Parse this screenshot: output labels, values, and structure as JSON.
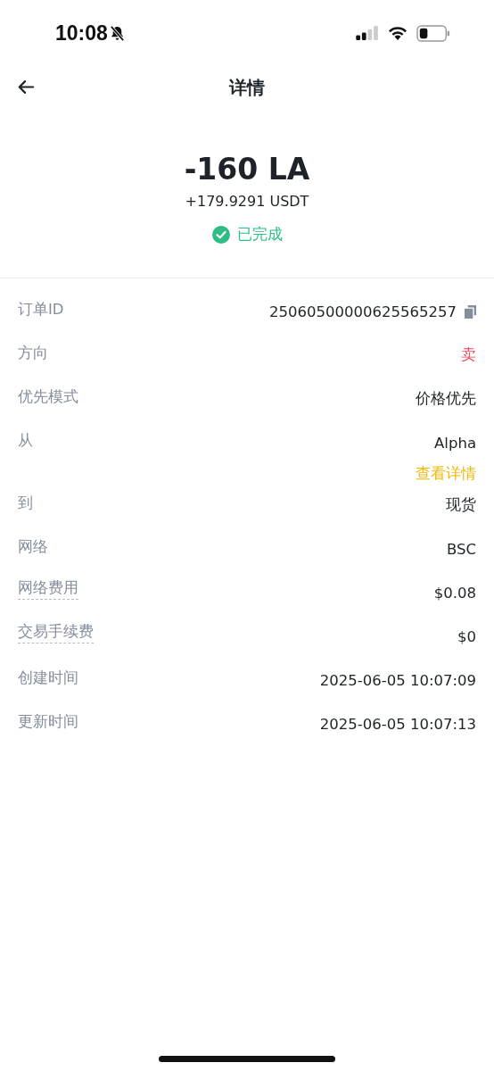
{
  "status_bar": {
    "time": "10:08",
    "silent": true
  },
  "header": {
    "title": "详情"
  },
  "summary": {
    "amount": "-160 LA",
    "received": "+179.9291 USDT",
    "status": "已完成"
  },
  "rows": [
    {
      "label": "订单ID",
      "value": "25060500000625565257",
      "kind": "copy",
      "dotted": false
    },
    {
      "label": "方向",
      "value": "卖",
      "kind": "sell",
      "dotted": false
    },
    {
      "label": "优先模式",
      "value": "价格优先",
      "kind": "plain",
      "dotted": false
    },
    {
      "label": "从",
      "value": "Alpha",
      "kind": "plain",
      "dotted": false,
      "link": "查看详情"
    },
    {
      "label": "到",
      "value": "现货",
      "kind": "plain",
      "dotted": false
    },
    {
      "label": "网络",
      "value": "BSC",
      "kind": "plain",
      "dotted": false
    },
    {
      "label": "网络费用",
      "value": "$0.08",
      "kind": "plain",
      "dotted": true
    },
    {
      "label": "交易手续费",
      "value": "$0",
      "kind": "plain",
      "dotted": true
    },
    {
      "label": "创建时间",
      "value": "2025-06-05 10:07:09",
      "kind": "plain",
      "dotted": false
    },
    {
      "label": "更新时间",
      "value": "2025-06-05 10:07:13",
      "kind": "plain",
      "dotted": false
    }
  ]
}
